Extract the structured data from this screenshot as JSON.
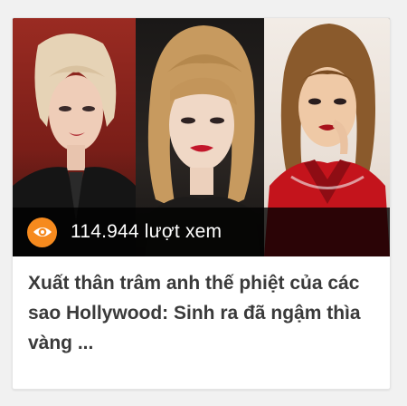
{
  "article": {
    "views_text": "114.944 lượt xem",
    "title": "Xuất thân trâm anh thế phiệt của các sao Hollywood: Sinh ra đã ngậm thìa vàng ...",
    "icon": "eye-icon",
    "accent_color": "#f68a1e"
  }
}
